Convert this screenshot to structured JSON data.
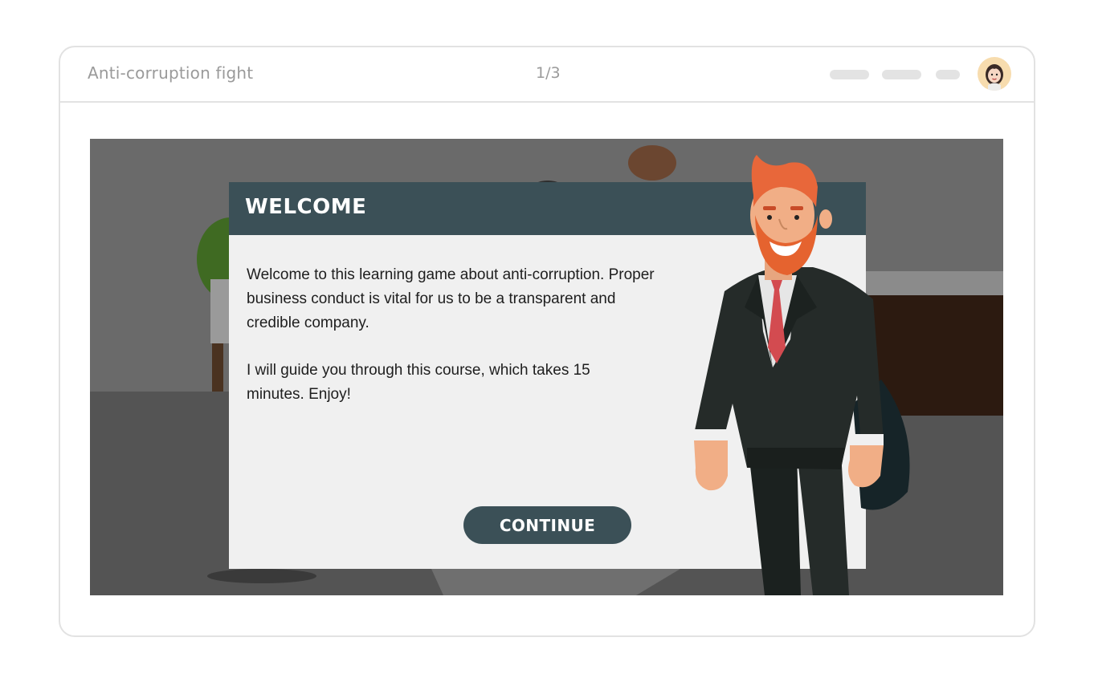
{
  "window": {
    "app_title": "Anti-corruption fight",
    "page_counter": "1/3",
    "avatar_icon": "user-avatar-icon"
  },
  "dialog": {
    "title": "WELCOME",
    "paragraph_1": "Welcome to this learning game about anti-corruption. Proper business conduct is vital for us to be a transparent and credible company.",
    "paragraph_2": "I will guide you through this course, which takes 15 minutes. Enjoy!",
    "continue_label": "CONTINUE"
  },
  "colors": {
    "accent": "#3b5057",
    "stage_bg": "#686868",
    "dialog_bg": "#f0f0f0",
    "hair": "#e8673a",
    "tie": "#d34b50",
    "suit": "#252b29"
  }
}
